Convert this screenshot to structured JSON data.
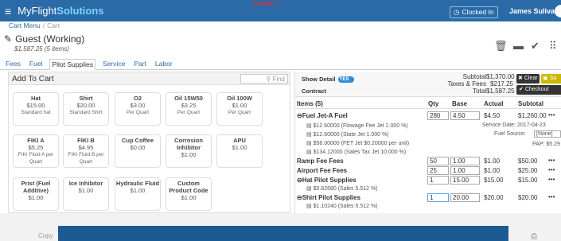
{
  "topbar": {
    "brand_a": "MyFlight",
    "brand_b": "Solutions",
    "client": "CLIENT 1",
    "clocked": "Clocked In",
    "user": "James Sulivan (Admin)"
  },
  "breadcrumb": {
    "a": "Cart Menu",
    "b": "Cart"
  },
  "header": {
    "title": "Guest (Working)",
    "subtitle": "$1,587.25 (5 items)"
  },
  "tabs": [
    "Fees",
    "Fuel",
    "Pilot Supplies",
    "Service",
    "Part",
    "Labor"
  ],
  "add": {
    "title": "Add To Cart",
    "find": "Find"
  },
  "products": [
    {
      "name": "Hat",
      "price": "$15.00",
      "desc": "Standard hat"
    },
    {
      "name": "Shirt",
      "price": "$20.00",
      "desc": "Standard Shirt"
    },
    {
      "name": "O2",
      "price": "$3.00",
      "desc": "Per Quart"
    },
    {
      "name": "Oil 15W50",
      "price": "$3.25",
      "desc": "Per Quart"
    },
    {
      "name": "Oil 100W",
      "price": "$1.00",
      "desc": "Per Quart"
    },
    {
      "name": "FIKI A",
      "price": "$5.25",
      "desc": "FIKI Fluid A per Quart"
    },
    {
      "name": "FIKI B",
      "price": "$4.95",
      "desc": "FIKI Fluid B per Quart"
    },
    {
      "name": "Cup Coffee",
      "price": "$0.00",
      "desc": ""
    },
    {
      "name": "Corrosion Inhibitor",
      "price": "$1.00",
      "desc": ""
    },
    {
      "name": "APU",
      "price": "$1.00",
      "desc": ""
    },
    {
      "name": "Prist (Fuel Additive)",
      "price": "$1.00",
      "desc": ""
    },
    {
      "name": "Ice Inhibitor",
      "price": "$1.00",
      "desc": ""
    },
    {
      "name": "Hydraulic Fluid",
      "price": "$1.00",
      "desc": ""
    },
    {
      "name": "Custom Product Code",
      "price": "$1.00",
      "desc": ""
    }
  ],
  "cart": {
    "show_detail": "Show Detail",
    "toggle": "YES",
    "contract": "Contract",
    "subtotal_l": "Subtotal",
    "subtotal_v": "$1,370.00",
    "tax_l": "Taxes & Fees",
    "tax_v": "$217.25",
    "total_l": "Total",
    "total_v": "$1,587.25",
    "clear": "Clear",
    "save": "Sa",
    "checkout": "Checkout",
    "cols": {
      "items": "Items (5)",
      "qty": "Qty",
      "base": "Base",
      "actual": "Actual",
      "subtotal": "Subtotal"
    },
    "fuel": {
      "name": "Fuel Jet-A Fuel",
      "qty": "280",
      "base": "4.50",
      "actual": "$4.50",
      "sub": "$1,260.00",
      "fees": [
        "$12.60000 (Flowage Fee Jet 1.000 %)",
        "$12.60000 (State Jet 1.000 %)",
        "$56.00000 (FET Jet $0.20000 per unit)",
        "$134.12000 (Sales Tax Jet 10.000 %)"
      ],
      "service_date": "Service Date: 2017-04-23",
      "fuel_source_l": "Fuel Source:",
      "fuel_source_v": "[None]",
      "pap": "PAP: $5.29"
    },
    "rows": [
      {
        "name": "Ramp Fee Fees",
        "qty": "50",
        "base": "1.00",
        "actual": "$1.00",
        "sub": "$50.00"
      },
      {
        "name": "Airport Fee Fees",
        "qty": "25",
        "base": "1.00",
        "actual": "$1.00",
        "sub": "$25.00"
      },
      {
        "name": "Hat Pilot Supplies",
        "qty": "1",
        "base": "15.00",
        "actual": "$15.00",
        "sub": "$15.00",
        "fee": "$0.82680 (Sales 5.512 %)"
      },
      {
        "name": "Shirt Pilot Supplies",
        "qty": "1",
        "base": "20.00",
        "actual": "$20.00",
        "sub": "$20.00",
        "fee": "$1.10240 (Sales 5.512 %)"
      }
    ],
    "more": "•••"
  },
  "footer": {
    "copy": "Copy"
  },
  "colors": {
    "topbar": "#2a6aa6",
    "accent": "#2e8dd8",
    "overlay": "#1d5a94"
  }
}
